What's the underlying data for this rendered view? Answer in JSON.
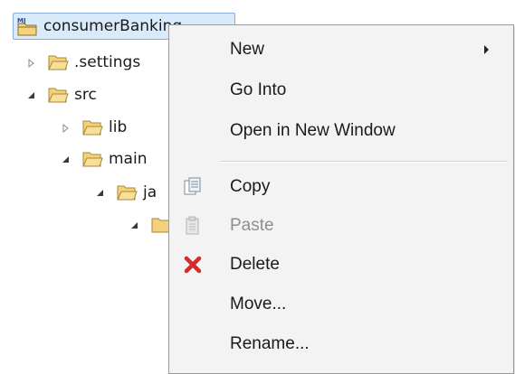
{
  "tree": {
    "root": {
      "label": "consumerBanking"
    },
    "items": [
      {
        "label": ".settings",
        "expanded": false
      },
      {
        "label": "src",
        "expanded": true
      },
      {
        "label": "lib",
        "expanded": false
      },
      {
        "label": "main",
        "expanded": true
      },
      {
        "label": "ja",
        "expanded": true
      }
    ]
  },
  "context_menu": {
    "new_label": "New",
    "go_into_label": "Go Into",
    "open_new_window_label": "Open in New Window",
    "copy_label": "Copy",
    "paste_label": "Paste",
    "delete_label": "Delete",
    "move_label": "Move...",
    "rename_label": "Rename..."
  },
  "colors": {
    "folder": "#e8b84a",
    "delete_icon": "#d62b2b",
    "selection_bg": "#d9ebfb",
    "menu_bg": "#f3f3f3"
  }
}
